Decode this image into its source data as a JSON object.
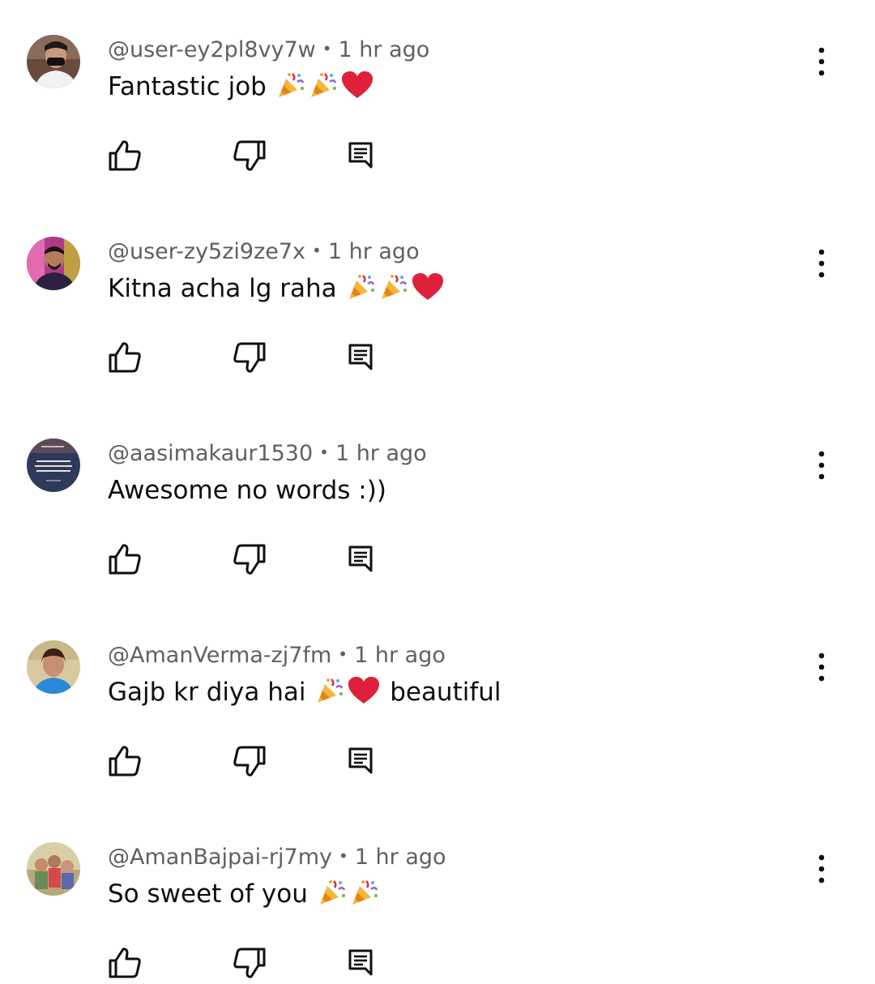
{
  "comments": [
    {
      "author": "@user-ey2pl8vy7w",
      "separator": "•",
      "time": "1 hr ago",
      "text_parts": [
        "Fantastic job",
        "🎉",
        "🎉",
        "❤️"
      ],
      "avatar_icon": "avatar-masked-man"
    },
    {
      "author": "@user-zy5zi9ze7x",
      "separator": "•",
      "time": "1 hr ago",
      "text_parts": [
        "Kitna acha lg raha",
        "🎉",
        "🎉",
        "❤️"
      ],
      "avatar_icon": "avatar-man-purple-bg"
    },
    {
      "author": "@aasimakaur1530",
      "separator": "•",
      "time": "1 hr ago",
      "text_parts": [
        "Awesome no words :))"
      ],
      "avatar_icon": "avatar-quote-card"
    },
    {
      "author": "@AmanVerma-zj7fm",
      "separator": "•",
      "time": "1 hr ago",
      "text_parts": [
        "Gajb kr diya hai",
        "🎉",
        "❤️",
        "beautiful"
      ],
      "avatar_icon": "avatar-woman"
    },
    {
      "author": "@AmanBajpai-rj7my",
      "separator": "•",
      "time": "1 hr ago",
      "text_parts": [
        "So sweet of you",
        "🎉",
        "🎉"
      ],
      "avatar_icon": "avatar-group-photo"
    }
  ],
  "icons": {
    "like": "thumb-up-icon",
    "dislike": "thumb-down-icon",
    "reply": "reply-icon",
    "more": "more-vertical-icon"
  },
  "colors": {
    "text": "#0f0f0f",
    "meta": "#606060",
    "background": "#ffffff"
  }
}
